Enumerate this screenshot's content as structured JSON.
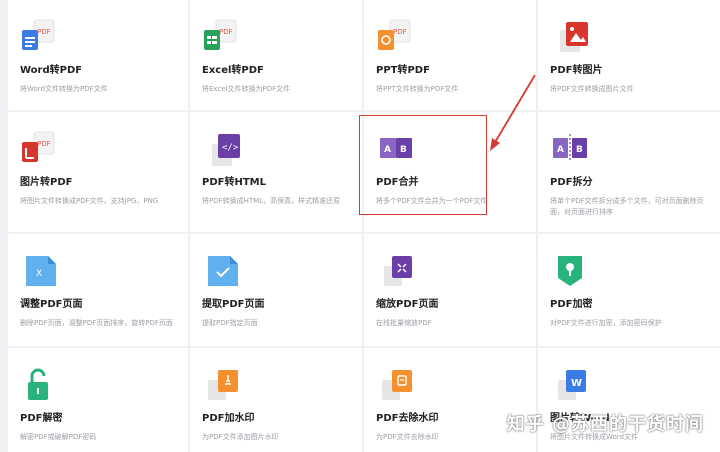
{
  "tools": [
    {
      "name": "tool-word-to-pdf",
      "icon": "word-to-pdf-icon",
      "title": "Word转PDF",
      "desc": "将Word文件转换为PDF文件",
      "desc2": ""
    },
    {
      "name": "tool-excel-to-pdf",
      "icon": "excel-to-pdf-icon",
      "title": "Excel转PDF",
      "desc": "将Excel文件转换为PDF文件",
      "desc2": ""
    },
    {
      "name": "tool-ppt-to-pdf",
      "icon": "ppt-to-pdf-icon",
      "title": "PPT转PDF",
      "desc": "将PPT文件转换为PDF文件",
      "desc2": ""
    },
    {
      "name": "tool-pdf-to-image",
      "icon": "pdf-to-image-icon",
      "title": "PDF转图片",
      "desc": "将PDF文件转换成图片文件",
      "desc2": ""
    },
    {
      "name": "tool-image-to-pdf",
      "icon": "image-to-pdf-icon",
      "title": "图片转PDF",
      "desc": "将图片文件转换成PDF文件，支持JPG、PNG",
      "desc2": ""
    },
    {
      "name": "tool-pdf-to-html",
      "icon": "pdf-to-html-icon",
      "title": "PDF转HTML",
      "desc": "将PDF转换成HTML，高保真，样式精准还原",
      "desc2": ""
    },
    {
      "name": "tool-pdf-merge",
      "icon": "pdf-merge-icon",
      "title": "PDF合并",
      "desc": "将多个PDF文件合并为一个PDF文件",
      "desc2": ""
    },
    {
      "name": "tool-pdf-split",
      "icon": "pdf-split-icon",
      "title": "PDF拆分",
      "desc": "将单个PDF文件拆分成多个文件，可对页面删除页",
      "desc2": "面，对页面进行排序"
    },
    {
      "name": "tool-adjust-pdf-pages",
      "icon": "adjust-pages-icon",
      "title": "调整PDF页面",
      "desc": "删除PDF页面，调整PDF页面排序，旋转PDF页面",
      "desc2": ""
    },
    {
      "name": "tool-extract-pdf-pages",
      "icon": "extract-pages-icon",
      "title": "提取PDF页面",
      "desc": "提取PDF指定页面",
      "desc2": ""
    },
    {
      "name": "tool-compress-pdf-pages",
      "icon": "compress-pages-icon",
      "title": "缩放PDF页面",
      "desc": "在线批量缩放PDF",
      "desc2": ""
    },
    {
      "name": "tool-pdf-encrypt",
      "icon": "pdf-encrypt-icon",
      "title": "PDF加密",
      "desc": "对PDF文件进行加密，添加密码保护",
      "desc2": ""
    },
    {
      "name": "tool-pdf-decrypt",
      "icon": "pdf-decrypt-icon",
      "title": "PDF解密",
      "desc": "解密PDF或破解PDF密码",
      "desc2": ""
    },
    {
      "name": "tool-pdf-add-watermark",
      "icon": "add-watermark-icon",
      "title": "PDF加水印",
      "desc": "为PDF文件添加图片水印",
      "desc2": ""
    },
    {
      "name": "tool-pdf-remove-watermark",
      "icon": "remove-watermark-icon",
      "title": "PDF去除水印",
      "desc": "为PDF文件去除水印",
      "desc2": ""
    },
    {
      "name": "tool-image-to-word",
      "icon": "image-to-word-icon",
      "title": "图片转Word",
      "desc": "将图片文件转换成Word文件",
      "desc2": ""
    }
  ],
  "watermark": "知乎 @苏西的干货时间",
  "colors": {
    "highlight": "#d63b33",
    "purple": "#7a55b5",
    "green": "#27b37a",
    "orange": "#f5902f",
    "blue": "#3c8be3"
  }
}
